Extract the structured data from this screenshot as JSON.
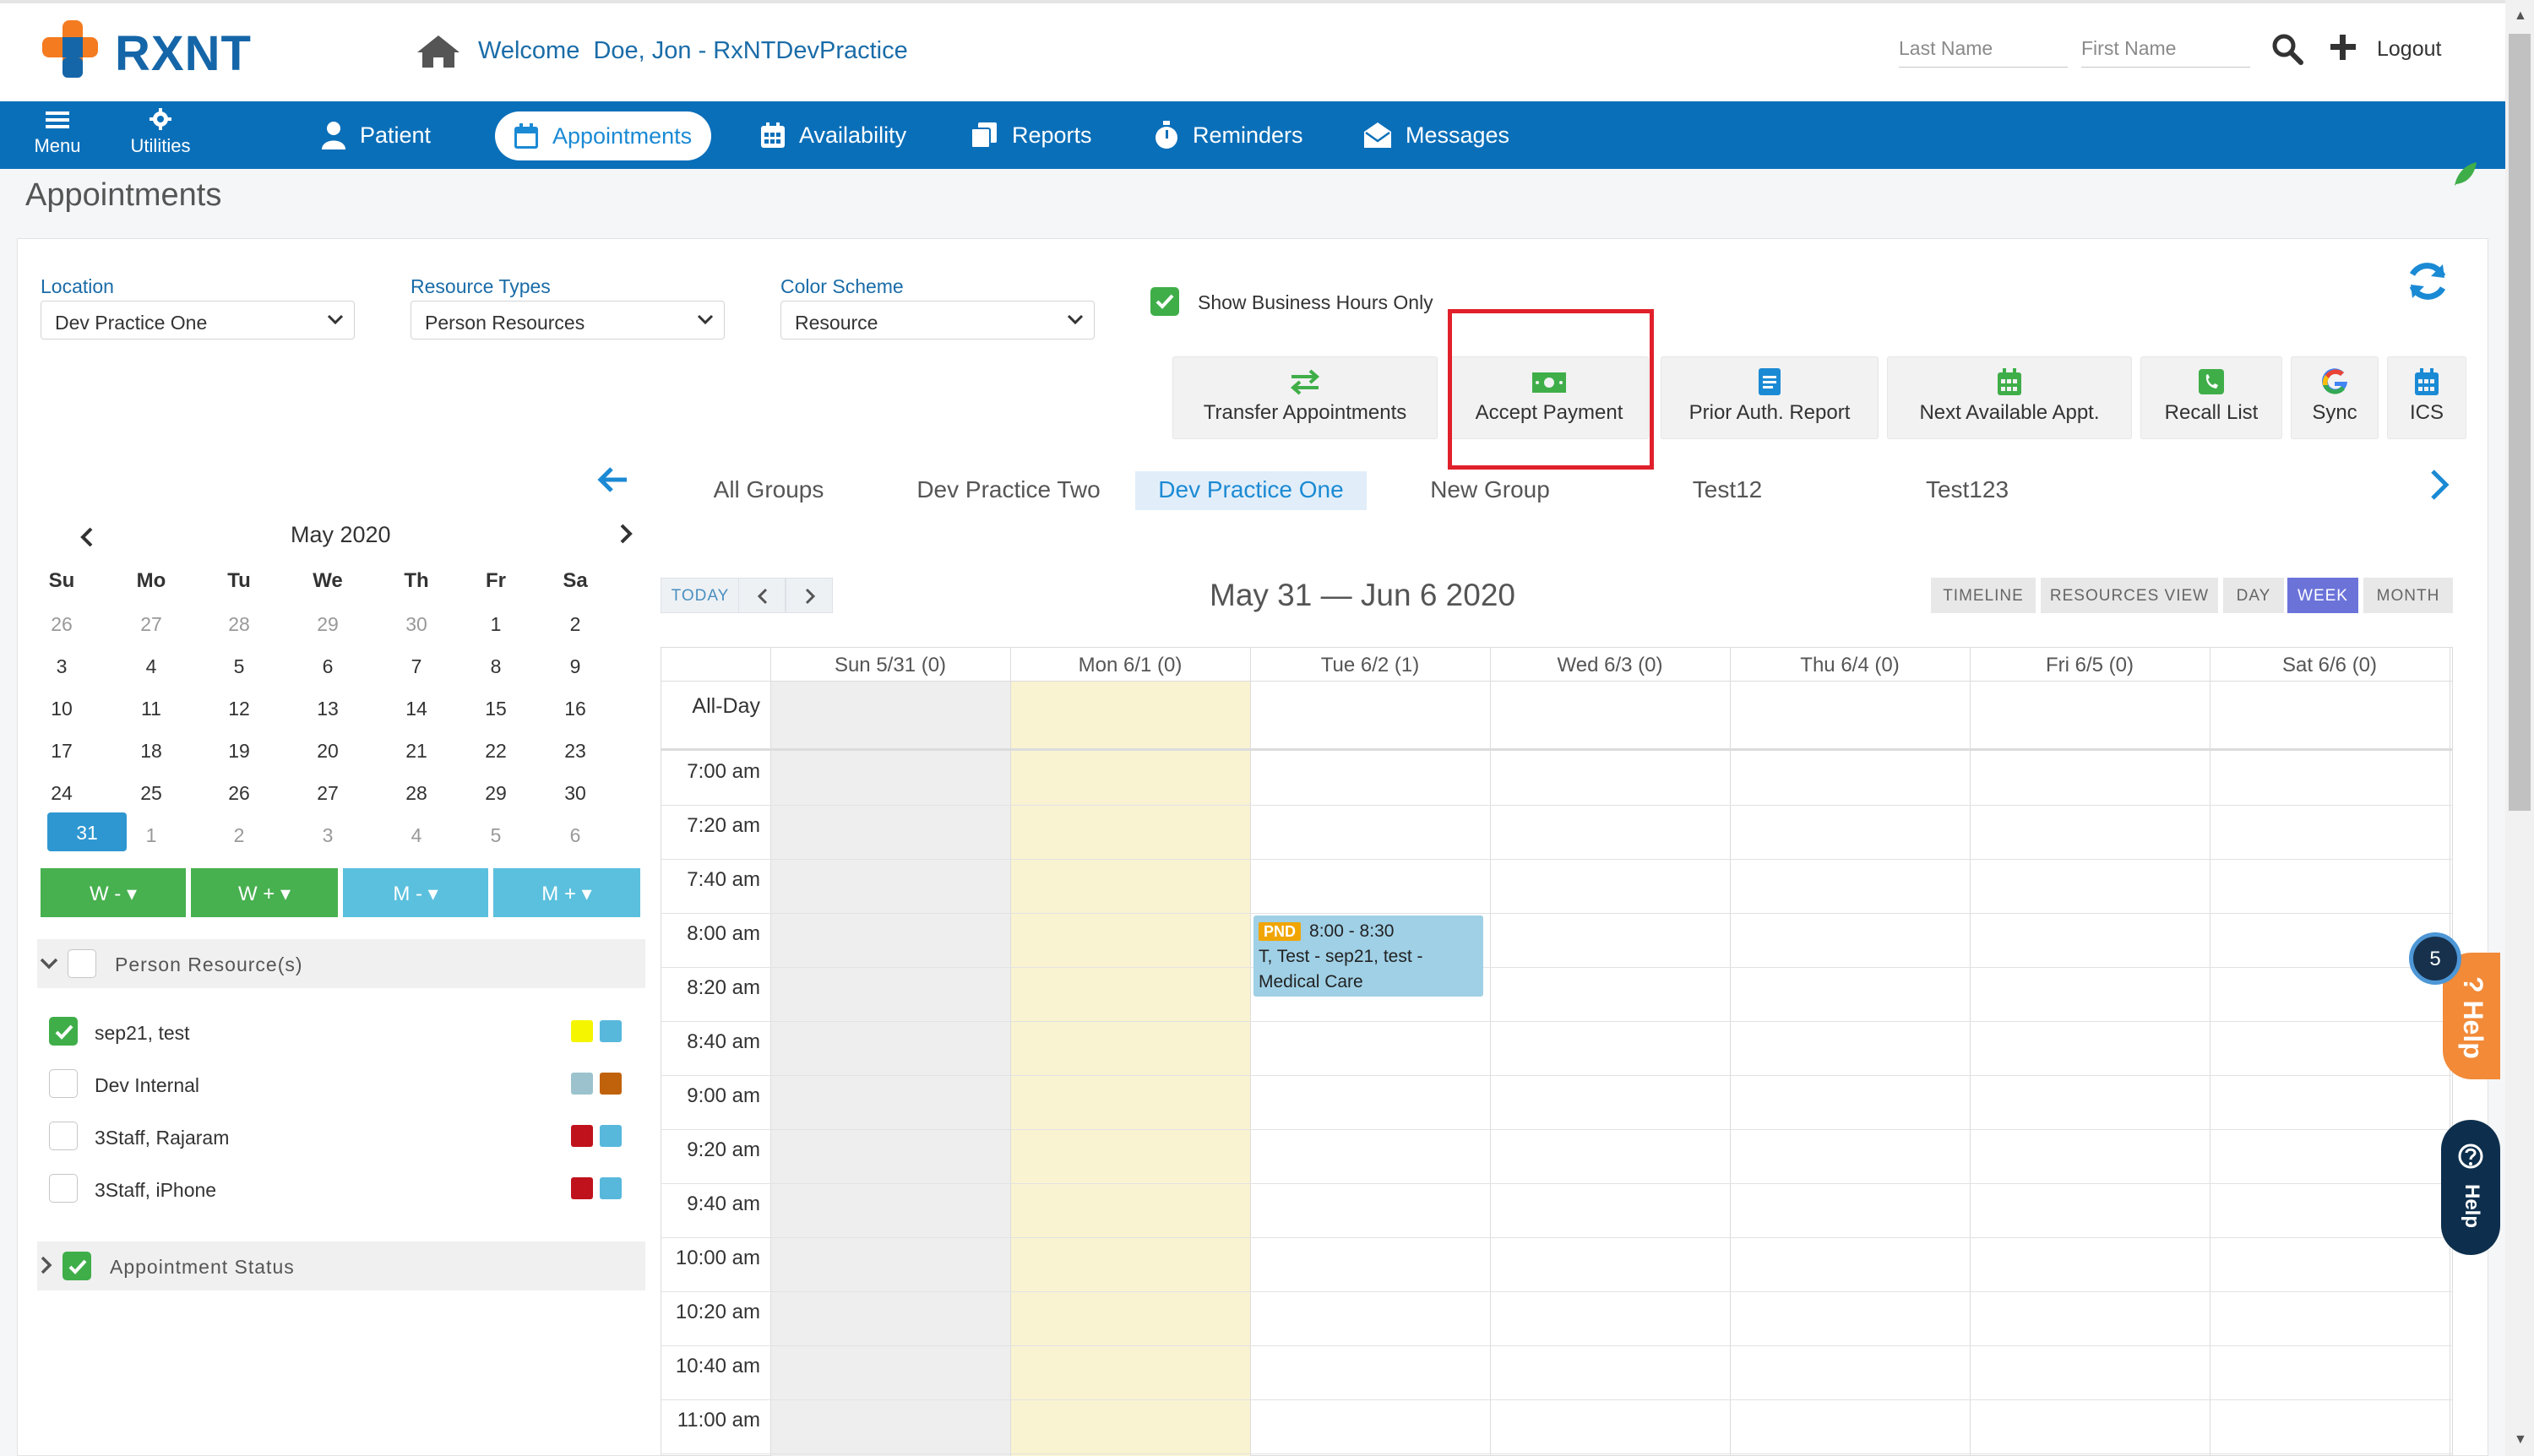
{
  "brand": {
    "name": "RXNT",
    "colors": {
      "primary": "#0a6fb9",
      "accent_orange": "#f47b20",
      "success": "#3fae49"
    }
  },
  "header": {
    "welcome_label": "Welcome",
    "user_name": "Doe, Jon - RxNTDevPractice",
    "last_name_placeholder": "Last Name",
    "first_name_placeholder": "First Name",
    "logout_label": "Logout"
  },
  "nav": {
    "menu_label": "Menu",
    "utilities_label": "Utilities",
    "items": [
      {
        "label": "Patient",
        "icon": "user-icon"
      },
      {
        "label": "Appointments",
        "icon": "calendar-icon",
        "active": true
      },
      {
        "label": "Availability",
        "icon": "calendar-grid-icon"
      },
      {
        "label": "Reports",
        "icon": "copy-icon"
      },
      {
        "label": "Reminders",
        "icon": "stopwatch-icon"
      },
      {
        "label": "Messages",
        "icon": "envelope-open-icon"
      }
    ]
  },
  "page": {
    "title": "Appointments"
  },
  "filters": {
    "location": {
      "label": "Location",
      "value": "Dev Practice One"
    },
    "resource_types": {
      "label": "Resource Types",
      "value": "Person Resources"
    },
    "color_scheme": {
      "label": "Color Scheme",
      "value": "Resource"
    },
    "business_hours_label": "Show Business Hours Only",
    "business_hours_checked": true
  },
  "toolbar": [
    {
      "label": "Transfer Appointments",
      "icon": "transfer-arrows-icon"
    },
    {
      "label": "Accept Payment",
      "icon": "money-icon",
      "highlighted": true
    },
    {
      "label": "Prior Auth. Report",
      "icon": "document-icon"
    },
    {
      "label": "Next Available Appt.",
      "icon": "calendar-grid-icon"
    },
    {
      "label": "Recall List",
      "icon": "phone-icon"
    },
    {
      "label": "Sync",
      "icon": "google-icon"
    },
    {
      "label": "ICS",
      "icon": "calendar-icon"
    }
  ],
  "groups": {
    "tabs": [
      "All Groups",
      "Dev Practice Two",
      "Dev Practice One",
      "New Group",
      "Test12",
      "Test123"
    ],
    "active": "Dev Practice One"
  },
  "mini_calendar": {
    "month_label": "May 2020",
    "weekdays": [
      "Su",
      "Mo",
      "Tu",
      "We",
      "Th",
      "Fr",
      "Sa"
    ],
    "weeks": [
      [
        "26",
        "27",
        "28",
        "29",
        "30",
        "1",
        "2"
      ],
      [
        "3",
        "4",
        "5",
        "6",
        "7",
        "8",
        "9"
      ],
      [
        "10",
        "11",
        "12",
        "13",
        "14",
        "15",
        "16"
      ],
      [
        "17",
        "18",
        "19",
        "20",
        "21",
        "22",
        "23"
      ],
      [
        "24",
        "25",
        "26",
        "27",
        "28",
        "29",
        "30"
      ],
      [
        "31",
        "1",
        "2",
        "3",
        "4",
        "5",
        "6"
      ]
    ],
    "selected": "31",
    "jump_buttons": [
      "W -",
      "W +",
      "M -",
      "M +"
    ]
  },
  "resources": {
    "heading": "Person Resource(s)",
    "items": [
      {
        "name": "sep21, test",
        "checked": true,
        "colors": [
          "#f5f500",
          "#58b8dc"
        ]
      },
      {
        "name": "Dev Internal",
        "checked": false,
        "colors": [
          "#9cc3cd",
          "#c0620c"
        ]
      },
      {
        "name": "3Staff, Rajaram",
        "checked": false,
        "colors": [
          "#c0121c",
          "#58b8dc"
        ]
      },
      {
        "name": "3Staff, iPhone",
        "checked": false,
        "colors": [
          "#c0121c",
          "#58b8dc"
        ]
      }
    ],
    "status_heading": "Appointment Status"
  },
  "calendar": {
    "today_label": "TODAY",
    "range_label": "May 31 — Jun 6 2020",
    "views": [
      "TIMELINE",
      "RESOURCES VIEW",
      "DAY",
      "WEEK",
      "MONTH"
    ],
    "active_view": "WEEK",
    "days": [
      "Sun 5/31 (0)",
      "Mon 6/1 (0)",
      "Tue 6/2 (1)",
      "Wed 6/3 (0)",
      "Thu 6/4 (0)",
      "Fri 6/5 (0)",
      "Sat 6/6 (0)"
    ],
    "allday_label": "All-Day",
    "times": [
      "7:00 am",
      "7:20 am",
      "7:40 am",
      "8:00 am",
      "8:20 am",
      "8:40 am",
      "9:00 am",
      "9:20 am",
      "9:40 am",
      "10:00 am",
      "10:20 am",
      "10:40 am",
      "11:00 am"
    ],
    "appointment": {
      "badge": "PND",
      "time": "8:00 - 8:30",
      "line1": "T, Test - sep21, test -",
      "line2": "Medical Care"
    }
  },
  "help": {
    "badge_count": "5",
    "label": "Help",
    "label2": "Help"
  }
}
